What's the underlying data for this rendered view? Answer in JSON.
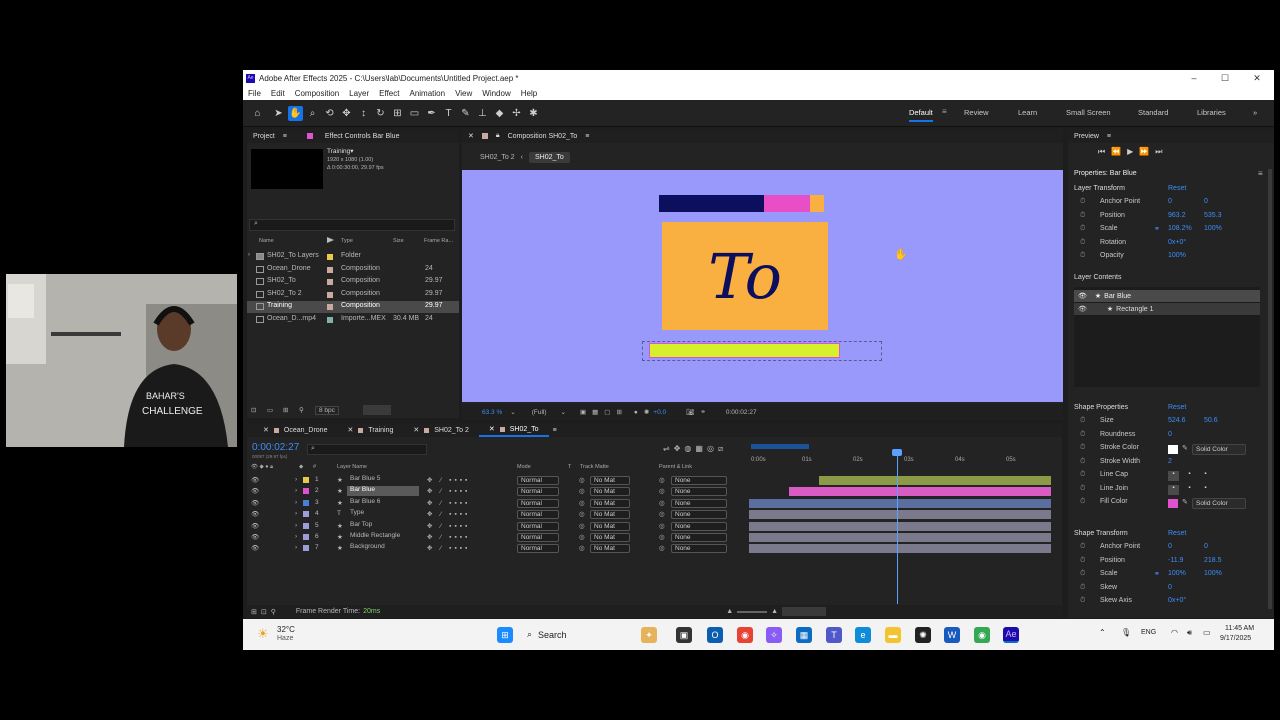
{
  "window": {
    "title": "Adobe After Effects 2025 - C:\\Users\\lab\\Documents\\Untitled Project.aep *",
    "logo": "Ae"
  },
  "menu": [
    "File",
    "Edit",
    "Composition",
    "Layer",
    "Effect",
    "Animation",
    "View",
    "Window",
    "Help"
  ],
  "workspaces": [
    "Default",
    "Review",
    "Learn",
    "Small Screen",
    "Standard",
    "Libraries"
  ],
  "project": {
    "tab_project": "Project",
    "tab_effects": "Effect Controls Bar Blue",
    "preview_name": "Training▾",
    "preview_info1": "1920 x 1080 (1.00)",
    "preview_info2": "Δ 0:00:30:00, 29.97 fps",
    "headers": {
      "name": "Name",
      "type": "Type",
      "size": "Size",
      "frame_rate": "Frame Ra..."
    },
    "items": [
      {
        "name": "SH02_To Layers",
        "type": "Folder",
        "size": "",
        "fps": "",
        "color": "#e8c94a"
      },
      {
        "name": "Ocean_Drone",
        "type": "Composition",
        "size": "",
        "fps": "24",
        "color": "#c9a9a0"
      },
      {
        "name": "SH02_To",
        "type": "Composition",
        "size": "",
        "fps": "29.97",
        "color": "#c9a9a0"
      },
      {
        "name": "SH02_To 2",
        "type": "Composition",
        "size": "",
        "fps": "29.97",
        "color": "#c9a9a0"
      },
      {
        "name": "Training",
        "type": "Composition",
        "size": "",
        "fps": "29.97",
        "color": "#c9a9a0"
      },
      {
        "name": "Ocean_D...mp4",
        "type": "Importe...MEX",
        "size": "30.4 MB",
        "fps": "24",
        "color": "#7fb3a5"
      }
    ],
    "bpc": "8 bpc"
  },
  "composition": {
    "tab": "Composition SH02_To",
    "crumbs": [
      "SH02_To 2",
      "SH02_To"
    ],
    "zoom": "63.3 %",
    "resolution": "(Full)",
    "exposure": "+0.0",
    "timecode": "0:00:02:27",
    "text": "To",
    "colors": {
      "bg": "#9999fb",
      "navy": "#0c0e5e",
      "pink": "#e84fc6",
      "orange": "#f9b041",
      "card": "#f9b041",
      "green": "#d6f02b"
    }
  },
  "preview": {
    "title": "Preview"
  },
  "properties": {
    "title": "Properties: Bar Blue",
    "layer_transform": "Layer Transform",
    "reset": "Reset",
    "transform": [
      {
        "label": "Anchor Point",
        "v1": "0",
        "v2": "0"
      },
      {
        "label": "Position",
        "v1": "963.2",
        "v2": "535.3"
      },
      {
        "label": "Scale",
        "v1": "108.2%",
        "v2": "100%"
      },
      {
        "label": "Rotation",
        "v1": "0x+0°",
        "v2": ""
      },
      {
        "label": "Opacity",
        "v1": "100%",
        "v2": ""
      }
    ],
    "layer_contents": "Layer Contents",
    "contents": [
      "Bar Blue",
      "Rectangle 1"
    ],
    "shape_properties": "Shape Properties",
    "shape": [
      {
        "label": "Size",
        "v1": "524.6",
        "v2": "50.6"
      },
      {
        "label": "Roundness",
        "v1": "0",
        "v2": ""
      },
      {
        "label": "Stroke Color",
        "v1": "",
        "v2": ""
      },
      {
        "label": "Stroke Width",
        "v1": "2",
        "v2": ""
      },
      {
        "label": "Line Cap",
        "v1": "",
        "v2": ""
      },
      {
        "label": "Line Join",
        "v1": "",
        "v2": ""
      },
      {
        "label": "Fill Color",
        "v1": "",
        "v2": ""
      }
    ],
    "solid_color": "Solid Color",
    "shape_transform": "Shape Transform",
    "shape_tf": [
      {
        "label": "Anchor Point",
        "v1": "0",
        "v2": "0"
      },
      {
        "label": "Position",
        "v1": "-11.9",
        "v2": "218.5"
      },
      {
        "label": "Scale",
        "v1": "100%",
        "v2": "100%"
      },
      {
        "label": "Skew",
        "v1": "0",
        "v2": ""
      },
      {
        "label": "Skew Axis",
        "v1": "0x+0°",
        "v2": ""
      }
    ],
    "fill_color": "#e052d0"
  },
  "timeline": {
    "tabs": [
      "Ocean_Drone",
      "Training",
      "SH02_To 2",
      "SH02_To"
    ],
    "timecode": "0:00:02:27",
    "sub_timecode": "00087 (29.97 fps)",
    "headers": {
      "layer_name": "Layer Name",
      "mode": "Mode",
      "t": "T",
      "track_matte": "Track Matte",
      "parent": "Parent & Link"
    },
    "ruler": [
      "0:00s",
      "01s",
      "02s",
      "03s",
      "04s",
      "05s"
    ],
    "layers": [
      {
        "num": "1",
        "name": "Bar Blue 5",
        "mode": "Normal",
        "matte": "No Mat",
        "parent": "None",
        "color": "#e8c94a",
        "bar": "#8c9a48"
      },
      {
        "num": "2",
        "name": "Bar Blue",
        "mode": "Normal",
        "matte": "No Mat",
        "parent": "None",
        "color": "#e052d0",
        "bar": "#d95cc4"
      },
      {
        "num": "3",
        "name": "Bar Blue 6",
        "mode": "Normal",
        "matte": "No Mat",
        "parent": "None",
        "color": "#4a7fd6",
        "bar": "#5a6ea0"
      },
      {
        "num": "4",
        "name": "Type",
        "mode": "Normal",
        "matte": "No Mat",
        "parent": "None",
        "color": "#9c9cd8",
        "bar": "#7a7a8c"
      },
      {
        "num": "5",
        "name": "Bar Top",
        "mode": "Normal",
        "matte": "No Mat",
        "parent": "None",
        "color": "#9c9cd8",
        "bar": "#7a7a8c"
      },
      {
        "num": "6",
        "name": "Middle Rectangle",
        "mode": "Normal",
        "matte": "No Mat",
        "parent": "None",
        "color": "#9c9cd8",
        "bar": "#7a7a8c"
      },
      {
        "num": "7",
        "name": "Background",
        "mode": "Normal",
        "matte": "No Mat",
        "parent": "None",
        "color": "#9c9cd8",
        "bar": "#7a7a8c"
      }
    ],
    "render_time_label": "Frame Render Time:",
    "render_time": "20ms"
  },
  "taskbar": {
    "weather_temp": "32°C",
    "weather_desc": "Haze",
    "search": "Search",
    "lang": "ENG",
    "time": "11:45 AM",
    "date": "9/17/2025"
  }
}
